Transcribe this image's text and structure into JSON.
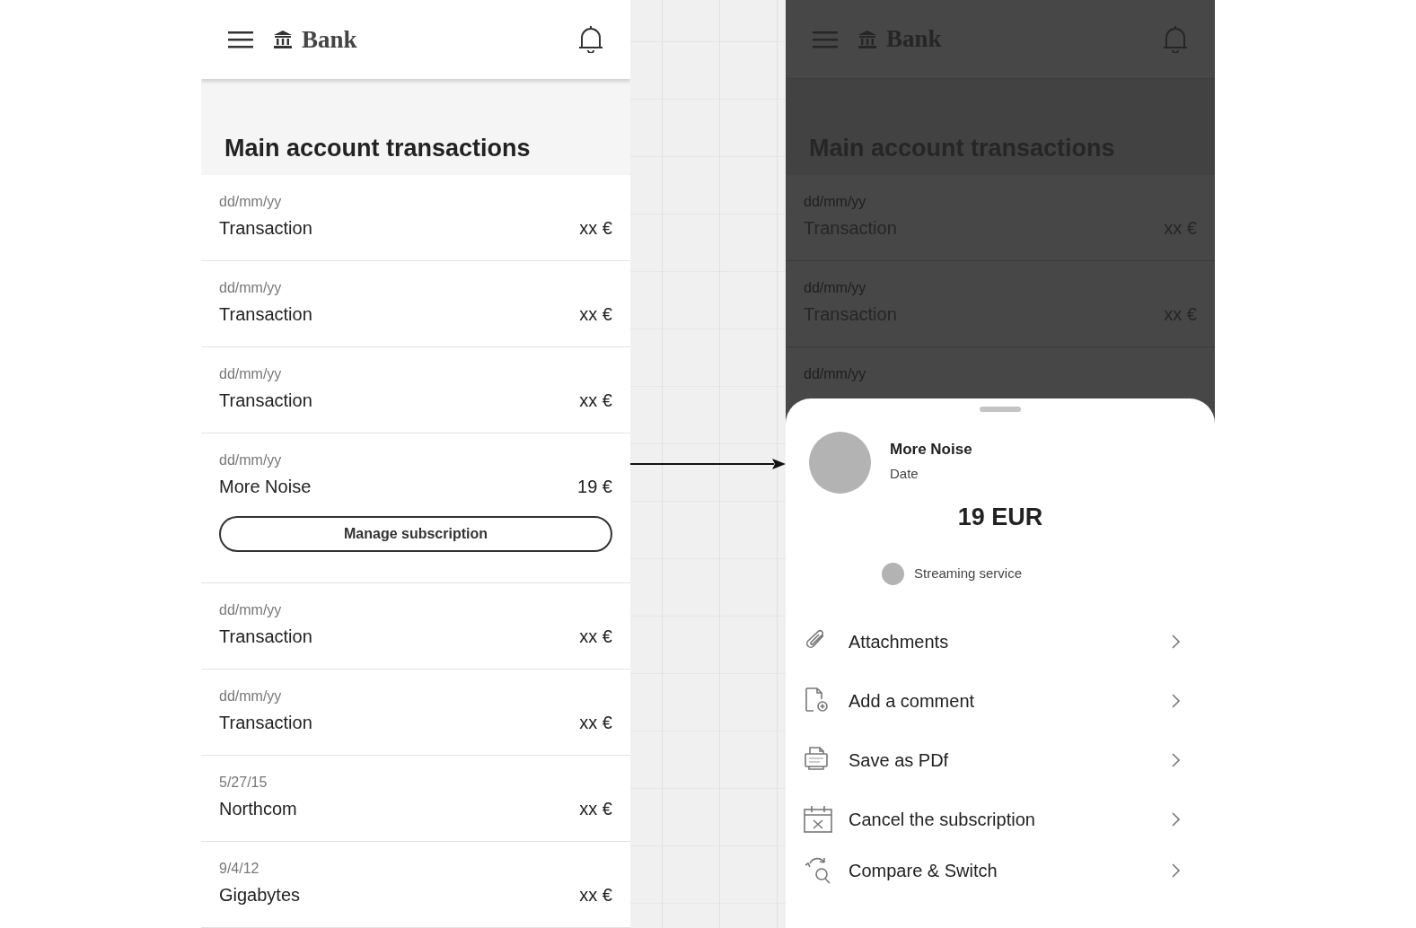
{
  "main_screen": {
    "header": {
      "title": "Bank"
    },
    "heading": "Main account transactions",
    "transactions": [
      {
        "date": "dd/mm/yy",
        "name": "Transaction",
        "amount": "xx €"
      },
      {
        "date": "dd/mm/yy",
        "name": "Transaction",
        "amount": "xx €"
      },
      {
        "date": "dd/mm/yy",
        "name": "Transaction",
        "amount": "xx €"
      },
      {
        "date": "dd/mm/yy",
        "name": "More Noise",
        "amount": "19 €",
        "button": "Manage subscription"
      },
      {
        "date": "dd/mm/yy",
        "name": "Transaction",
        "amount": "xx €"
      },
      {
        "date": "dd/mm/yy",
        "name": "Transaction",
        "amount": "xx €"
      },
      {
        "date": "5/27/15",
        "name": "Northcom",
        "amount": "xx €"
      },
      {
        "date": "9/4/12",
        "name": "Gigabytes",
        "amount": "xx €"
      }
    ]
  },
  "detail_screen": {
    "header": {
      "title": "Bank"
    },
    "heading": "Main account transactions",
    "transactions": [
      {
        "date": "dd/mm/yy",
        "name": "Transaction",
        "amount": "xx €"
      },
      {
        "date": "dd/mm/yy",
        "name": "Transaction",
        "amount": "xx €"
      },
      {
        "date": "dd/mm/yy"
      }
    ],
    "sheet": {
      "merchant": "More Noise",
      "date": "Date",
      "amount": "19 EUR",
      "category": "Streaming service",
      "actions": [
        {
          "kind": "attachment",
          "label": "Attachments"
        },
        {
          "kind": "comment",
          "label": "Add a comment"
        },
        {
          "kind": "pdf",
          "label": "Save as PDf"
        },
        {
          "kind": "cancel",
          "label": "Cancel the subscription"
        },
        {
          "kind": "compare",
          "label": "Compare & Switch"
        }
      ]
    }
  }
}
